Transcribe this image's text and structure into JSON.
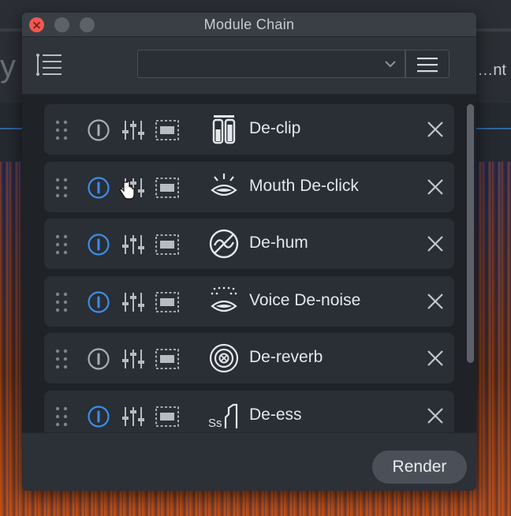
{
  "background": {
    "right_text": "…nt"
  },
  "window": {
    "title": "Module Chain"
  },
  "toolbar": {
    "preset_value": ""
  },
  "modules": [
    {
      "name": "De-clip",
      "enabled": false,
      "icon": "de-clip-icon"
    },
    {
      "name": "Mouth De-click",
      "enabled": true,
      "icon": "mouth-declick-icon"
    },
    {
      "name": "De-hum",
      "enabled": true,
      "icon": "de-hum-icon"
    },
    {
      "name": "Voice De-noise",
      "enabled": true,
      "icon": "voice-denoise-icon"
    },
    {
      "name": "De-reverb",
      "enabled": false,
      "icon": "de-reverb-icon"
    },
    {
      "name": "De-ess",
      "enabled": true,
      "icon": "de-ess-icon"
    }
  ],
  "footer": {
    "render_label": "Render"
  },
  "colors": {
    "accent": "#3b8ee8",
    "power_off": "#a9adb3",
    "close_red": "#ee5a52"
  }
}
